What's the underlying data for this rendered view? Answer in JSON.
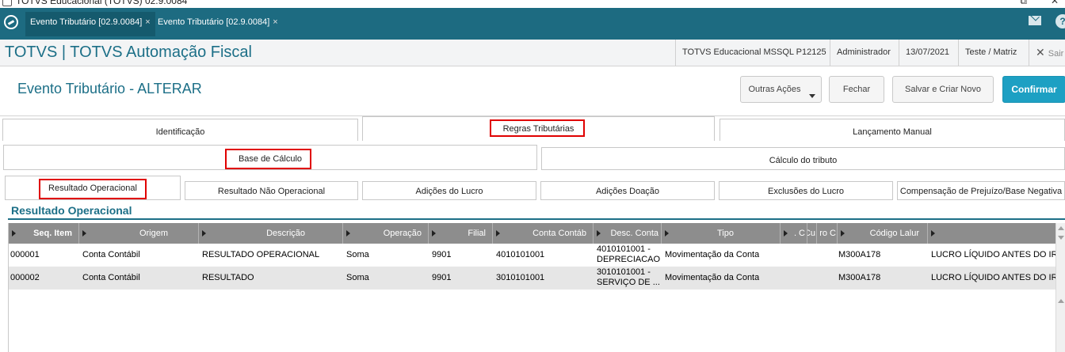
{
  "window": {
    "title": "TOTVS Educacional (TOTVS) 02.9.0084",
    "restore_glyph": "⧉",
    "close_glyph": "✕"
  },
  "tabs": [
    {
      "label": "Evento Tributário [02.9.0084]",
      "close": "×"
    },
    {
      "label": "Evento Tributário [02.9.0084]",
      "close": "×"
    }
  ],
  "header": {
    "app_title": "TOTVS | TOTVS Automação Fiscal",
    "environment": "TOTVS Educacional MSSQL P12125",
    "user": "Administrador",
    "date": "13/07/2021",
    "company": "Teste / Matriz",
    "logout_label": "Sair",
    "logout_glyph": "✕",
    "help_glyph": "?"
  },
  "page": {
    "title": "Evento Tributário - ALTERAR"
  },
  "actions": {
    "other": "Outras Ações",
    "close": "Fechar",
    "save_new": "Salvar e Criar Novo",
    "confirm": "Confirmar"
  },
  "tabs_l1": [
    "Identificação",
    "Regras Tributárias",
    "Lançamento Manual"
  ],
  "tabs_l2": [
    "Base de Cálculo",
    "Cálculo do tributo"
  ],
  "tabs_l3": [
    "Resultado Operacional",
    "Resultado Não Operacional",
    "Adições do Lucro",
    "Adições Doação",
    "Exclusões do Lucro",
    "Compensação de Prejuízo/Base Negativa"
  ],
  "section": {
    "title": "Resultado Operacional"
  },
  "grid": {
    "columns": [
      "Seq. Item",
      "Origem",
      "Descrição",
      "Operação",
      "Filial",
      "Conta Contáb",
      "Desc. Conta",
      "Tipo",
      ". C",
      "Cu",
      "ro C",
      "Código Lalur",
      ""
    ],
    "rows": [
      {
        "seq": "000001",
        "origem": "Conta Contábil",
        "descricao": "RESULTADO OPERACIONAL",
        "operacao": "Soma",
        "filial": "9901",
        "conta": "4010101001",
        "desc_conta_1": "4010101001 -",
        "desc_conta_2": "DEPRECIACAO",
        "tipo": "Movimentação da Conta",
        "lalur": "M300A178",
        "extra": "LUCRO LÍQUIDO ANTES DO IRPJ"
      },
      {
        "seq": "000002",
        "origem": "Conta Contábil",
        "descricao": "RESULTADO",
        "operacao": "Soma",
        "filial": "9901",
        "conta": "3010101001",
        "desc_conta_1": "3010101001 -",
        "desc_conta_2": "SERVIÇO DE ...",
        "tipo": "Movimentação da Conta",
        "lalur": "M300A178",
        "extra": "LUCRO LÍQUIDO ANTES DO IRPJ"
      }
    ]
  },
  "colors": {
    "brand": "#1d6b81",
    "title_blue": "#1c6f87",
    "confirm": "#1da0c3",
    "highlight": "#e00000",
    "grid_header": "#8d8d8d"
  }
}
